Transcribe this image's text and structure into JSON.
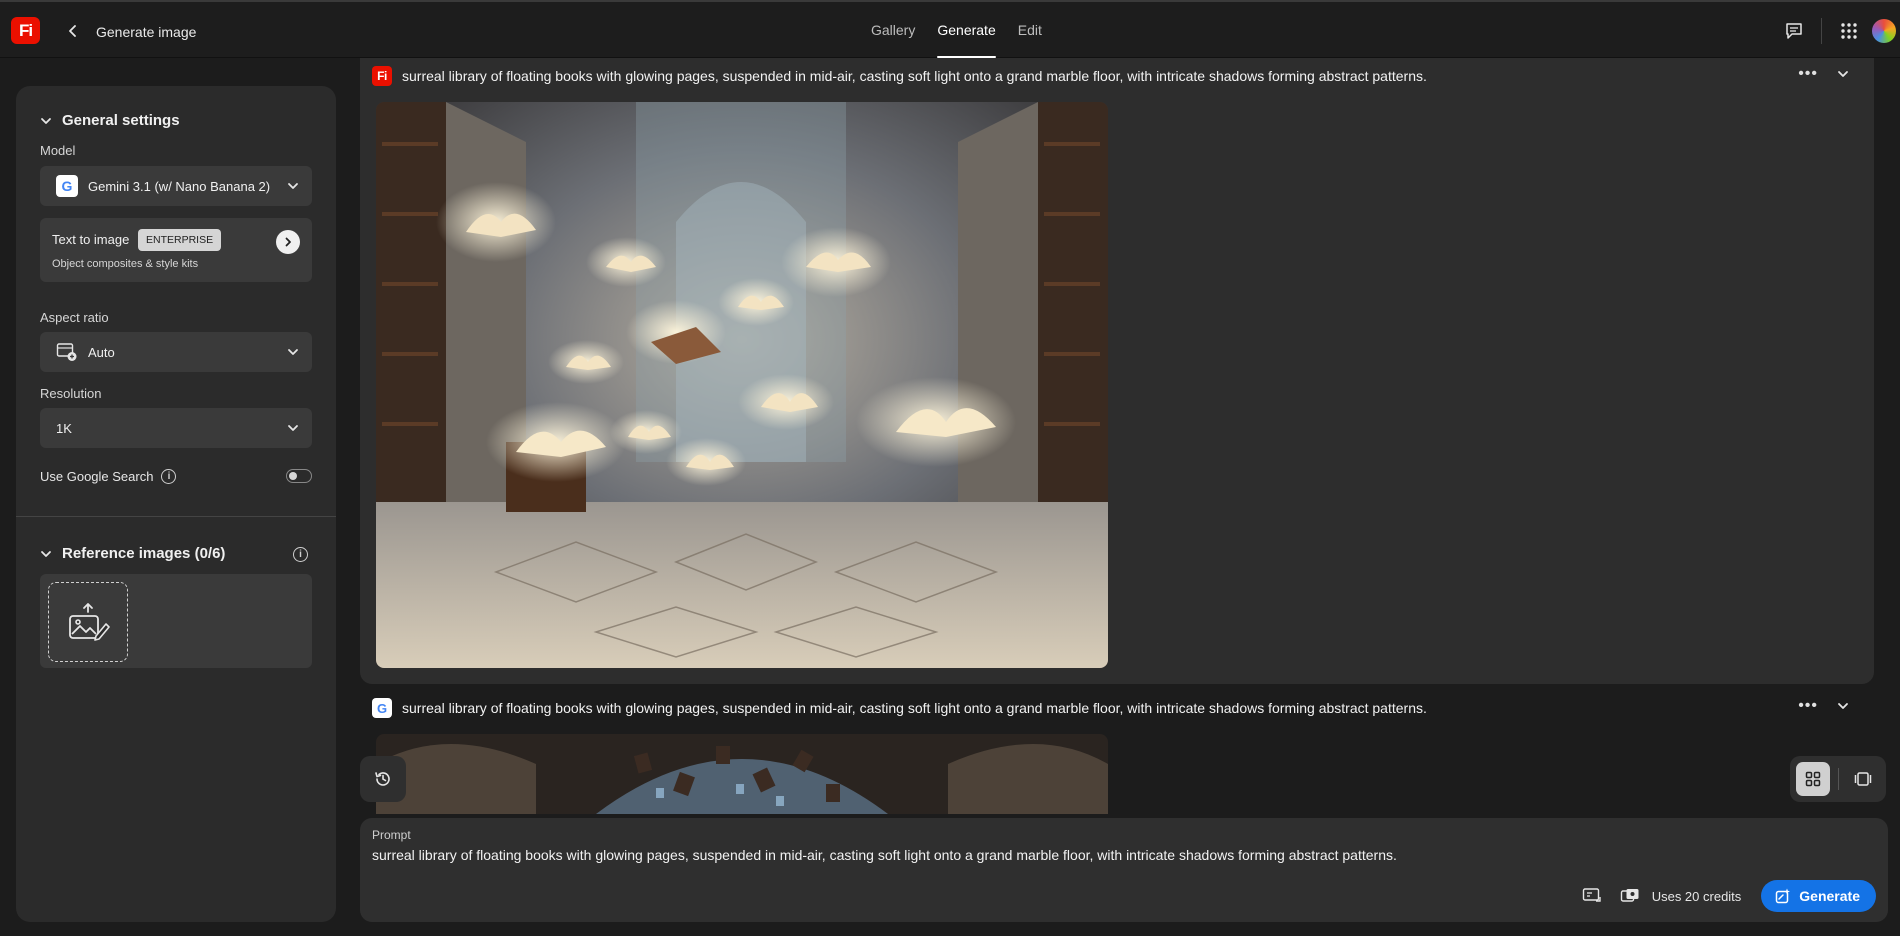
{
  "app": {
    "logo_text": "Fi",
    "page_title": "Generate image",
    "tabs": [
      {
        "label": "Gallery",
        "active": false
      },
      {
        "label": "Generate",
        "active": true
      },
      {
        "label": "Edit",
        "active": false
      }
    ],
    "icons": [
      "back-icon",
      "chat-icon",
      "apps-grid-icon",
      "avatar"
    ]
  },
  "sidebar": {
    "general_settings": {
      "title": "General settings",
      "model_label": "Model",
      "model_value": "Gemini 3.1 (w/ Nano Banana 2)",
      "model_badge": "G",
      "text_to_image": {
        "title": "Text to image",
        "badge": "ENTERPRISE",
        "subtitle": "Object composites & style kits"
      },
      "aspect_ratio_label": "Aspect ratio",
      "aspect_ratio_value": "Auto",
      "resolution_label": "Resolution",
      "resolution_value": "1K",
      "google_search_label": "Use Google Search",
      "google_search_enabled": false
    },
    "reference_images": {
      "title": "Reference images (0/6)"
    }
  },
  "results": [
    {
      "source": "firefly",
      "source_badge": "Fi",
      "prompt": "surreal library of floating books with glowing pages, suspended in mid-air, casting soft light onto a grand marble floor, with intricate shadows forming abstract patterns."
    },
    {
      "source": "google",
      "source_badge": "G",
      "prompt": "surreal library of floating books with glowing pages, suspended in mid-air, casting soft light onto a grand marble floor, with intricate shadows forming abstract patterns."
    }
  ],
  "prompt_box": {
    "label": "Prompt",
    "value": "surreal library of floating books with glowing pages, suspended in mid-air, casting soft light onto a grand marble floor, with intricate shadows forming abstract patterns.",
    "credits": "Uses 20 credits",
    "generate_label": "Generate"
  },
  "colors": {
    "accent": "#1473e6",
    "brand": "#eb1000",
    "background": "#1c1c1c",
    "panel": "#2b2b2b"
  }
}
